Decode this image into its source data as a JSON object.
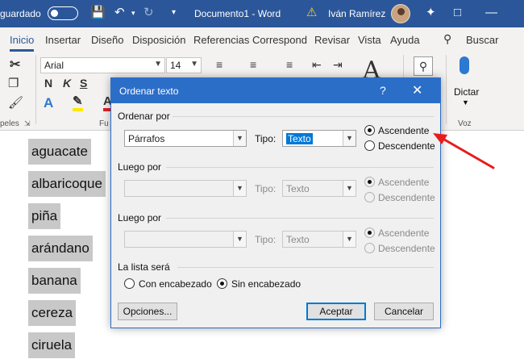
{
  "titlebar": {
    "autosave_label": "guardado",
    "doc_title": "Documento1  -  Word",
    "user_name": "Iván Ramírez"
  },
  "tabs": [
    "Inicio",
    "Insertar",
    "Diseño",
    "Disposición",
    "Referencias",
    "Correspondencia",
    "Revisar",
    "Vista",
    "Ayuda"
  ],
  "search_label": "Buscar",
  "ribbon": {
    "font_name": "Arial",
    "font_size": "14",
    "bold": "N",
    "italic": "K",
    "underline": "S",
    "clipboard_group": "peles",
    "font_group": "Fu",
    "dictate_label": "Dictar",
    "voice_group": "Voz"
  },
  "document_words": [
    "aguacate",
    "albaricoque",
    "piña",
    "arándano",
    "banana",
    "cereza",
    "ciruela"
  ],
  "dialog": {
    "title": "Ordenar texto",
    "help": "?",
    "sort_by_label": "Ordenar por",
    "sort_by_value": "Párrafos",
    "type_label": "Tipo:",
    "type_value": "Texto",
    "ascending": "Ascendente",
    "descending": "Descendente",
    "then_by_1_label": "Luego por",
    "then_by_2_label": "Luego por",
    "list_header_label": "La lista será",
    "with_header": "Con encabezado",
    "without_header": "Sin encabezado",
    "options_button": "Opciones...",
    "ok_button": "Aceptar",
    "cancel_button": "Cancelar"
  },
  "colors": {
    "word_blue": "#2b579a",
    "dialog_blue": "#2b6ec8",
    "arrow_red": "#e81c1c"
  }
}
